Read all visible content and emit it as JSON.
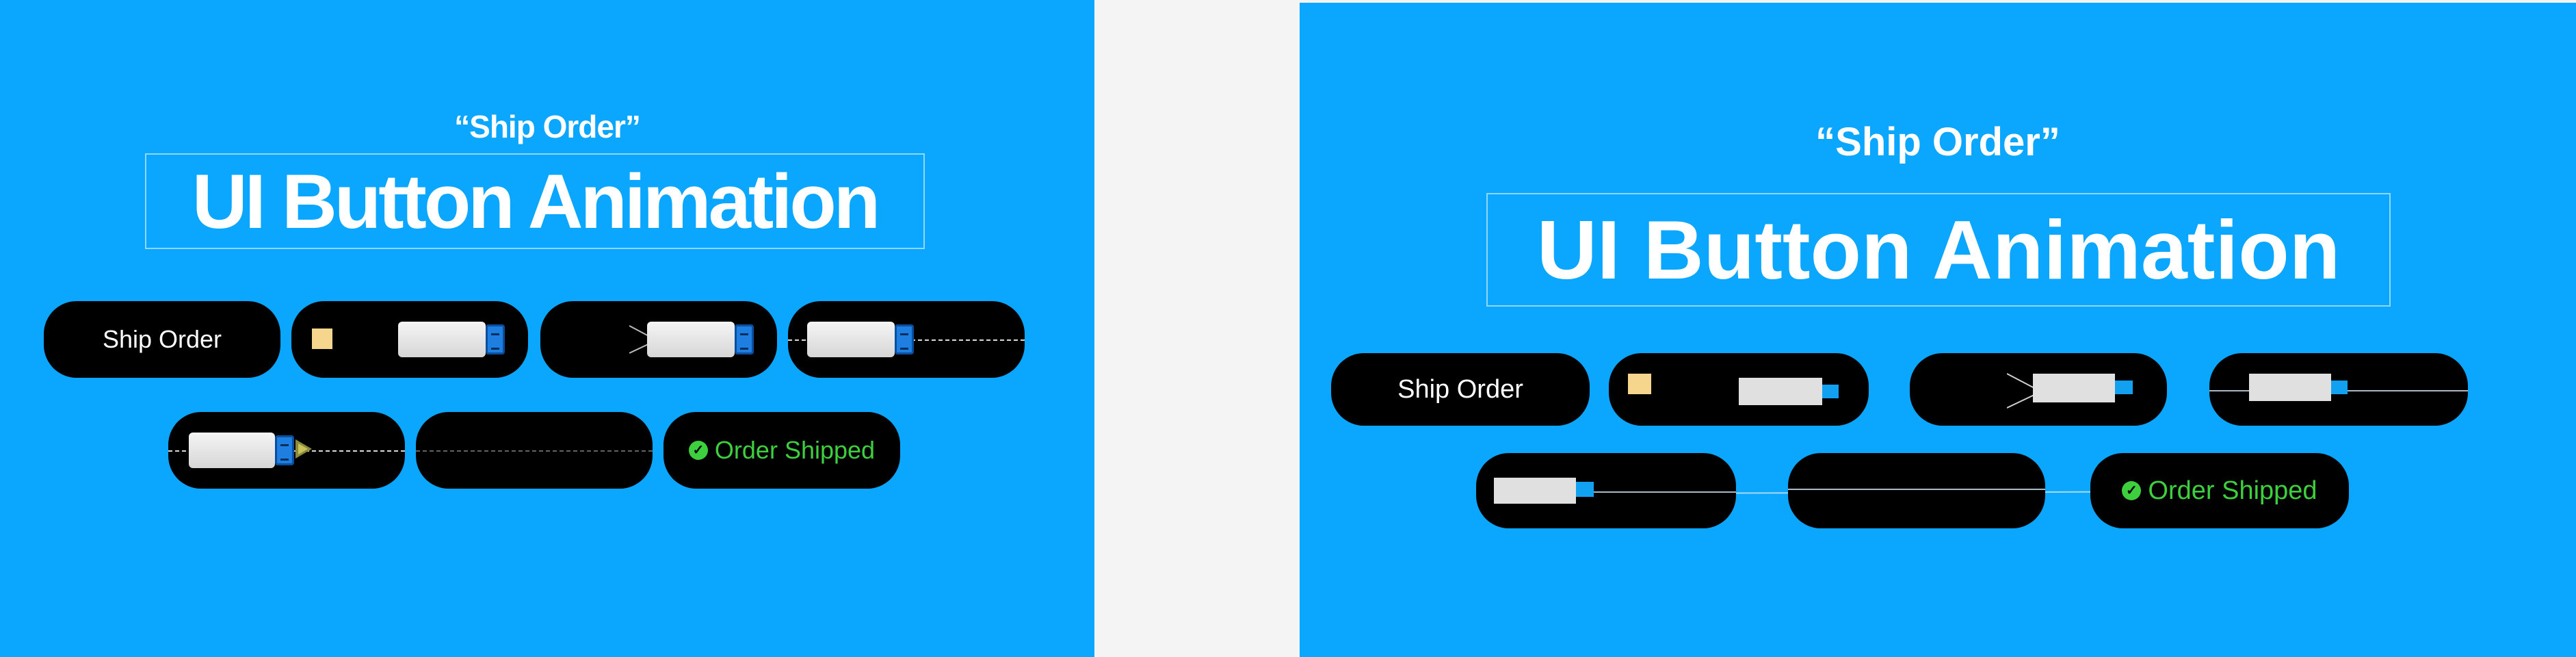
{
  "left": {
    "subtitle": "“Ship Order”",
    "title": "UI Button Animation",
    "button_label": "Ship Order",
    "success_label": "Order Shipped"
  },
  "right": {
    "subtitle": "“Ship Order”",
    "title": "UI Button Animation",
    "button_label": "Ship Order",
    "success_label": "Order Shipped"
  },
  "colors": {
    "panel_background": "#0ba6fe",
    "outer_background": "#f4f4f4",
    "button_background": "#000000",
    "success_green": "#3ecf3e",
    "package_note": "#f6d58d",
    "truck_cab": "#1f7fe0"
  },
  "icons": [
    "package-note-icon",
    "truck-icon",
    "speed-lines-icon",
    "road-line",
    "check-circle-icon"
  ]
}
